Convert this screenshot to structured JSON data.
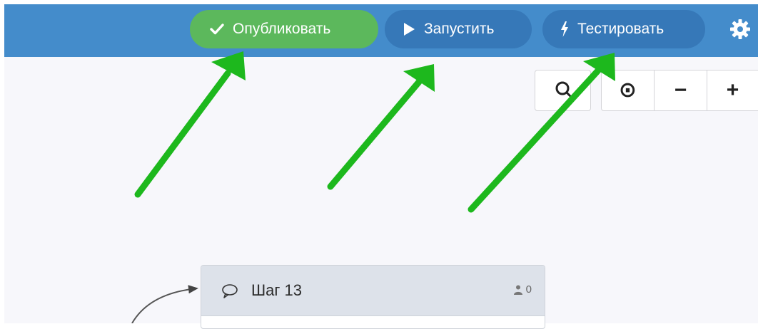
{
  "toolbar": {
    "publish_label": "Опубликовать",
    "run_label": "Запустить",
    "test_label": "Тестировать",
    "settings_icon": "gear-icon",
    "publish_color": "#5cb85c",
    "bar_color": "#448ccb",
    "button_color": "#3678b8"
  },
  "zoom_controls": {
    "center_symbol": "⊙",
    "minus_symbol": "−",
    "plus_symbol": "+",
    "search_icon": "search-icon"
  },
  "step": {
    "title": "Шаг 13",
    "users_count": "0",
    "header_color": "#dde2ea"
  },
  "annotations": {
    "arrow_color": "#1db81d",
    "arrow_count": 3
  }
}
